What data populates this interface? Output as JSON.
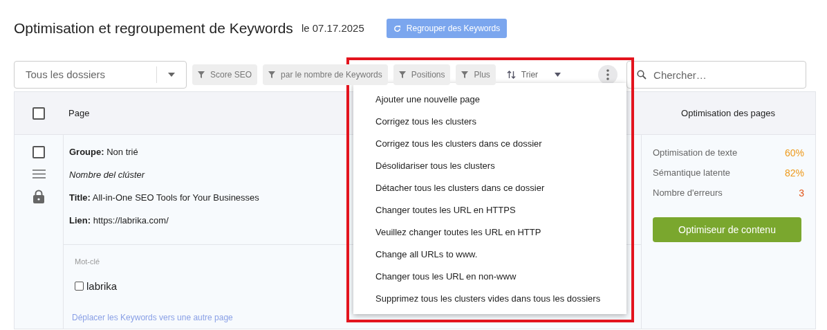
{
  "header": {
    "title": "Optimisation et regroupement de Keywords",
    "date": "le 07.17.2025",
    "regroup_button": "Regrouper des Keywords"
  },
  "folder_select": {
    "value": "Tous les dossiers"
  },
  "filters": [
    {
      "label": "Score SEO"
    },
    {
      "label": "par le nombre de Keywords"
    },
    {
      "label": "Positions"
    },
    {
      "label": "Plus"
    }
  ],
  "sort": {
    "label": "Trier"
  },
  "search": {
    "placeholder": "Chercher…"
  },
  "table": {
    "columns": [
      "Page",
      "Optimisation des pages"
    ],
    "header_checked": false,
    "rows": [
      {
        "checked": false,
        "group": "**Groupe:** Non trié",
        "cluster_name": "Nombre del clúster",
        "title": "**Title:** All-in-One SEO Tools for Your Businesses",
        "link": "**Lien:** https://labrika.com/",
        "keywords_heading": "Mot-clé",
        "keywords": [
          {
            "text": "labrika",
            "checked": false
          }
        ],
        "move_link": "Déplacer les Keywords vers une autre page",
        "metrics": [
          {
            "label": "Optimisation de texte",
            "value": "60%",
            "color": "#ee9a1c"
          },
          {
            "label": "Sémantique latente",
            "value": "82%",
            "color": "#ee9a1c"
          },
          {
            "label": "Nombre d'erreurs",
            "value": "3",
            "color": "#e2561b"
          }
        ],
        "optimizer_button": "Optimiseur de contenu"
      }
    ]
  },
  "menu": {
    "items": [
      "Ajouter une nouvelle page",
      "Corrigez tous les clusters",
      "Corrigez tous les clusters dans ce dossier",
      "Désolidariser tous les clusters",
      "Détacher tous les clusters dans ce dossier",
      "Changer toutes les URL en HTTPS",
      "Veuillez changer toutes les URL en HTTP",
      "Change all URLs to www.",
      "Changer tous les URL en non-www",
      "Supprimez tous les clusters vides dans tous les dossiers"
    ]
  },
  "highlight": {
    "shown": true
  }
}
